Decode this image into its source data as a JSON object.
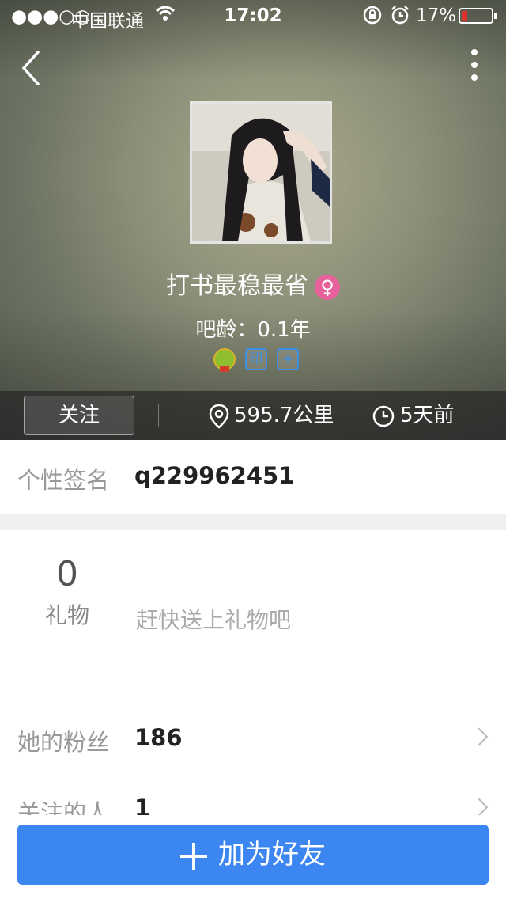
{
  "status_bar": {
    "signal": "●●●○○",
    "carrier": "中国联通",
    "time": "17:02",
    "battery_percent": "17%"
  },
  "profile": {
    "name": "打书最稳最省",
    "gender_icon": "female-icon",
    "gender_symbol": "♀",
    "bar_age": "吧龄：0.1年",
    "badge_yin": "印",
    "badge_plus": "+"
  },
  "actions": {
    "follow_label": "关注",
    "distance": "595.7公里",
    "last_active": "5天前"
  },
  "signature": {
    "label": "个性签名",
    "value": "q229962451"
  },
  "gifts": {
    "count": "0",
    "label": "礼物",
    "hint": "赶快送上礼物吧"
  },
  "fans": {
    "label": "她的粉丝",
    "value": "186"
  },
  "following": {
    "label": "关注的人",
    "value": "1"
  },
  "bottom_button": {
    "label": "加为好友"
  },
  "colors": {
    "accent_blue": "#3b86f0",
    "female_pink": "#e8609c",
    "battery_low": "#e03030"
  }
}
